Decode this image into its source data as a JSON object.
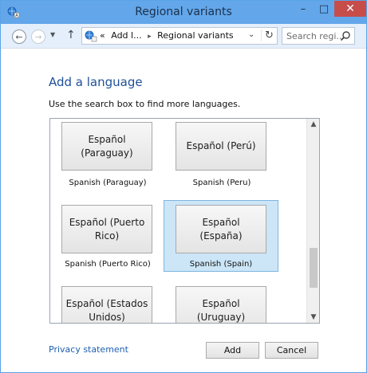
{
  "window": {
    "title": "Regional variants",
    "minimize_glyph": "–",
    "maximize_glyph": "□",
    "close_glyph": "✕"
  },
  "navbar": {
    "back_glyph": "←",
    "forward_glyph": "→",
    "dropdown_glyph": "▼",
    "up_glyph": "↑",
    "address": {
      "overflow": "«",
      "crumb_parent": "Add l...",
      "separator": "▸",
      "crumb_current": "Regional variants",
      "dropdown_glyph": "⌄",
      "refresh_glyph": "↻"
    },
    "search": {
      "placeholder": "Search regi..."
    }
  },
  "main": {
    "heading": "Add a language",
    "instructions": "Use the search box to find more languages."
  },
  "tiles": [
    {
      "button_text": "Español (Paraguay)",
      "label": "Spanish (Paraguay)",
      "selected": false
    },
    {
      "button_text": "Español (Perú)",
      "label": "Spanish (Peru)",
      "selected": false
    },
    {
      "button_text": "Español (Puerto Rico)",
      "label": "Spanish (Puerto Rico)",
      "selected": false
    },
    {
      "button_text": "Español (España)",
      "label": "Spanish (Spain)",
      "selected": true
    },
    {
      "button_text": "Español (Estados Unidos)",
      "label": "",
      "selected": false
    },
    {
      "button_text": "Español (Uruguay)",
      "label": "",
      "selected": false
    }
  ],
  "scrollbar": {
    "up_glyph": "▲",
    "down_glyph": "▼",
    "position_fraction": 0.7
  },
  "footer": {
    "privacy_link": "Privacy statement",
    "add_label": "Add",
    "cancel_label": "Cancel"
  },
  "colors": {
    "titlebar": "#63a7ea",
    "close_button": "#c74d4b",
    "heading": "#1e4f99",
    "selected_tile": "#cce6f7",
    "link": "#1e5fb0"
  }
}
